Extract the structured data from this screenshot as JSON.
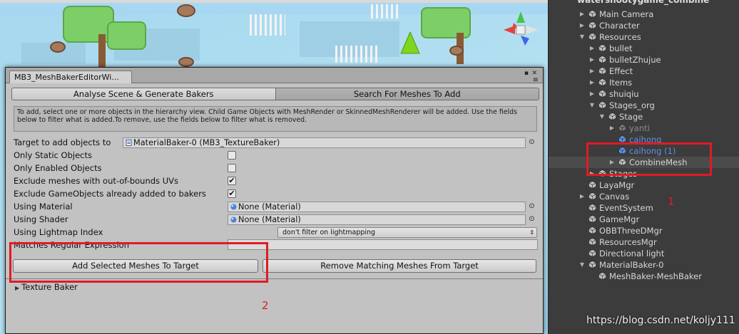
{
  "editor_window": {
    "tab_title": "MB3_MeshBakerEditorWi...",
    "menu_icon": "≡",
    "tabs": [
      {
        "label": "Analyse Scene & Generate Bakers",
        "active": false
      },
      {
        "label": "Search For Meshes To Add",
        "active": true
      }
    ],
    "help_text": "To add, select one or more objects in the hierarchy view. Child Game Objects with MeshRender or SkinnedMeshRenderer will be added. Use the fields below to filter what is added.To remove, use the fields below to filter what is removed.",
    "target": {
      "label": "Target to add objects to",
      "value": "MaterialBaker-0 (MB3_TextureBaker)"
    },
    "only_static": {
      "label": "Only Static Objects",
      "checked": false
    },
    "only_enabled": {
      "label": "Only Enabled Objects",
      "checked": false
    },
    "exclude_uvs": {
      "label": "Exclude meshes with out-of-bounds UVs",
      "checked": true
    },
    "exclude_added": {
      "label": "Exclude GameObjects already added to bakers",
      "checked": true
    },
    "using_material": {
      "label": "Using Material",
      "value": "None (Material)"
    },
    "using_shader": {
      "label": "Using Shader",
      "value": "None (Material)"
    },
    "lightmap_index": {
      "label": "Using Lightmap Index",
      "value": "don't filter on lightmapping"
    },
    "regex": {
      "label": "Matches Regular Expression",
      "value": ""
    },
    "add_button": "Add Selected Meshes To Target",
    "remove_button": "Remove Matching Meshes From Target",
    "texture_baker_foldout": "Texture Baker"
  },
  "annotations": {
    "label_1": "1",
    "label_2": "2",
    "color": "#e01b24"
  },
  "hierarchy": {
    "header_cutoff": "watershootygame_combine",
    "items": [
      {
        "label": "Main Camera",
        "arrow": "▶"
      },
      {
        "label": "Character",
        "arrow": "▶"
      },
      {
        "label": "Resources",
        "arrow": "▼"
      },
      {
        "label": "bullet",
        "arrow": "▶"
      },
      {
        "label": "bulletZhujue",
        "arrow": "▶"
      },
      {
        "label": "Effect",
        "arrow": "▶"
      },
      {
        "label": "Items",
        "arrow": "▶"
      },
      {
        "label": "shuiqiu",
        "arrow": "▶"
      },
      {
        "label": "Stages_org",
        "arrow": "▼"
      },
      {
        "label": "Stage",
        "arrow": "▼"
      },
      {
        "label": "yanti",
        "arrow": "▶"
      },
      {
        "label": "caihong",
        "arrow": ""
      },
      {
        "label": "caihong (1)",
        "arrow": ""
      },
      {
        "label": "CombineMesh",
        "arrow": "▶"
      },
      {
        "label": "Stages",
        "arrow": "▶"
      },
      {
        "label": "LayaMgr",
        "arrow": ""
      },
      {
        "label": "Canvas",
        "arrow": "▶"
      },
      {
        "label": "EventSystem",
        "arrow": ""
      },
      {
        "label": "GameMgr",
        "arrow": ""
      },
      {
        "label": "OBBThreeDMgr",
        "arrow": ""
      },
      {
        "label": "ResourcesMgr",
        "arrow": ""
      },
      {
        "label": "Directional light",
        "arrow": ""
      },
      {
        "label": "MaterialBaker-0",
        "arrow": "▼"
      },
      {
        "label": "MeshBaker-MeshBaker",
        "arrow": ""
      }
    ]
  },
  "watermark": "https://blog.csdn.net/koljy111",
  "icons": {
    "gameobject": "cube-icon",
    "prefab": "prefab-cube-icon",
    "material": "material-sphere-icon",
    "picker": "object-picker-icon",
    "checkmark": "✔"
  }
}
